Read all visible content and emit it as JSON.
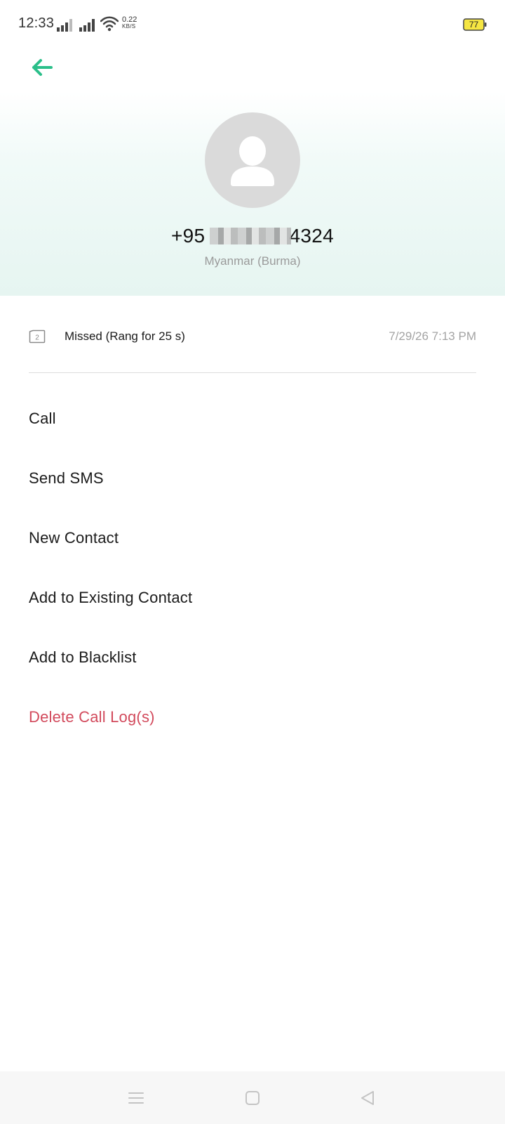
{
  "status_bar": {
    "time": "12:33",
    "net_speed_value": "0.22",
    "net_speed_unit": "KB/S",
    "battery_level": "77",
    "battery_color": "#f5e642"
  },
  "header": {
    "phone_prefix": "+95",
    "phone_suffix": "4324",
    "country": "Myanmar (Burma)",
    "accent_color": "#2bbf8a"
  },
  "call_log": {
    "sim_label": "2",
    "status": "Missed (Rang for 25 s)",
    "timestamp": "7/29/26 7:13 PM"
  },
  "actions": [
    {
      "label": "Call"
    },
    {
      "label": "Send SMS"
    },
    {
      "label": "New Contact"
    },
    {
      "label": "Add to Existing Contact"
    },
    {
      "label": "Add to Blacklist"
    },
    {
      "label": "Delete Call Log(s)",
      "color": "#d24a5c"
    }
  ],
  "icons": {
    "back": "arrow-left-icon",
    "avatar": "person-icon",
    "sim": "sim-card-icon",
    "nav_menu": "menu-icon",
    "nav_home": "home-icon",
    "nav_back": "back-triangle-icon"
  }
}
